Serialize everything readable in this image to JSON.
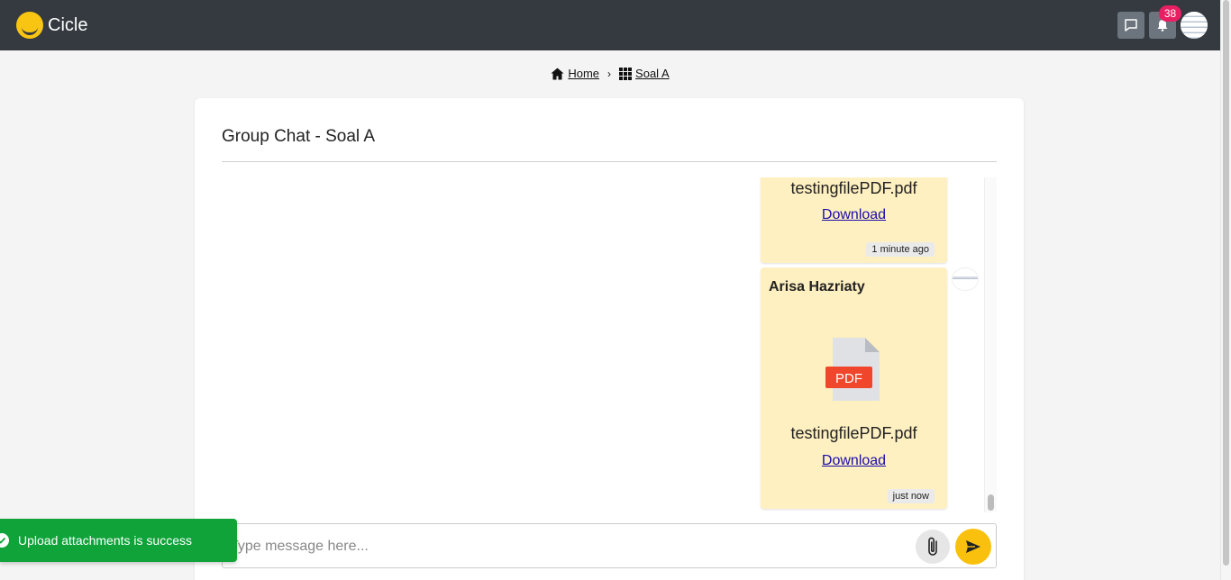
{
  "app": {
    "name": "Cicle"
  },
  "topbar": {
    "chat_icon": "chat-bubble-icon",
    "bell_icon": "bell-icon",
    "notification_count": "38",
    "colors": {
      "background": "#343a40",
      "badge": "#e91e63",
      "logo": "#f9c513"
    }
  },
  "breadcrumb": {
    "items": [
      {
        "label": "Home",
        "icon": "home-icon"
      },
      {
        "label": "Soal A",
        "icon": "grid-icon"
      }
    ],
    "separator": "›"
  },
  "chat": {
    "title": "Group Chat - Soal A",
    "messages": [
      {
        "file_name": "testingfilePDF.pdf",
        "download_label": "Download",
        "time": "1 minute ago"
      },
      {
        "sender": "Arisa Hazriaty",
        "file_icon": "pdf-file-icon",
        "file_icon_label": "PDF",
        "file_name": "testingfilePDF.pdf",
        "download_label": "Download",
        "time": "just now"
      }
    ],
    "bubble_color": "#fff0c1"
  },
  "composer": {
    "placeholder": "Type message here...",
    "attach_icon": "paperclip-icon",
    "send_icon": "send-icon",
    "send_color": "#f9c10d"
  },
  "toast": {
    "message": "Upload attachments is success",
    "icon": "check-circle-icon",
    "color": "#0fa33a"
  }
}
